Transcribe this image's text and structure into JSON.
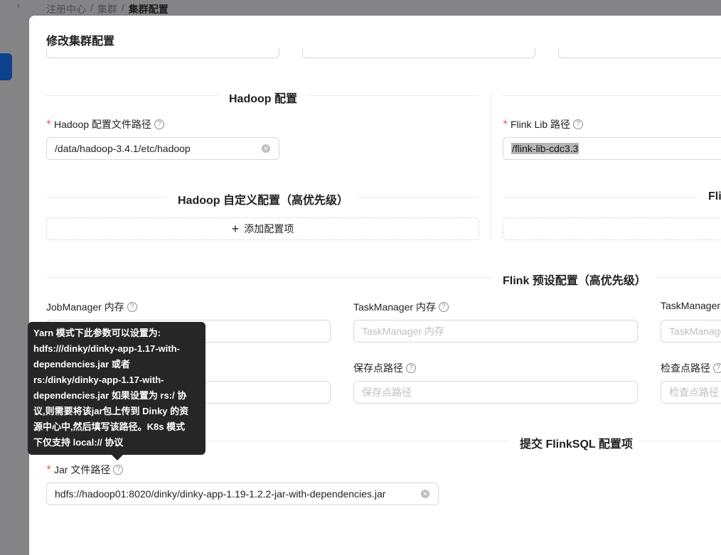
{
  "breadcrumb": [
    "注册中心",
    "集群",
    "集群配置"
  ],
  "breadcrumb_sep": "/",
  "back_icon": "‹",
  "modal": {
    "title": "修改集群配置"
  },
  "hadoop": {
    "section_title": "Hadoop 配置",
    "conf_path_label": "Hadoop 配置文件路径",
    "conf_path_value": "/data/hadoop-3.4.1/etc/hadoop",
    "custom_title": "Hadoop 自定义配置（高优先级）",
    "add_label": "添加配置项"
  },
  "flink": {
    "lib_label": "Flink Lib 路径",
    "lib_value": "/flink-lib-cdc3.3",
    "custom_title_partial": "Fli"
  },
  "preset": {
    "section_title": "Flink 预设配置（高优先级）",
    "jm_label": "JobManager 内存",
    "tm_label": "TaskManager 内存",
    "tm_placeholder": "TaskManager 内存",
    "tm3_label": "TaskManager",
    "tm3_placeholder": "TaskManage",
    "savepoint_label": "保存点路径",
    "savepoint_placeholder": "保存点路径",
    "checkpoint_label": "检查点路径",
    "checkpoint_placeholder": "检查点路径"
  },
  "submit": {
    "section_title": "提交 FlinkSQL 配置项",
    "jar_label": "Jar 文件路径",
    "jar_value": "hdfs://hadoop01:8020/dinky/dinky-app-1.19-1.2.2-jar-with-dependencies.jar"
  },
  "tooltip": {
    "lines": [
      "Yarn 模式下此参数可以设置为:",
      "hdfs:///dinky/dinky-app-1.17-with-",
      "dependencies.jar 或者",
      "rs:/dinky/dinky-app-1.17-with-",
      "dependencies.jar 如果设置为 rs:/ 协",
      "议,则需要将该jar包上传到 Dinky 的资",
      "源中心中,然后填写该路径。K8s 模式",
      "下仅支持 local:// 协议"
    ]
  },
  "icons": {
    "question": "?",
    "clear": "✕",
    "plus": "+"
  },
  "colors": {
    "required": "#ff4d4f",
    "primary": "#1677ff",
    "tooltip_bg": "#262626"
  }
}
